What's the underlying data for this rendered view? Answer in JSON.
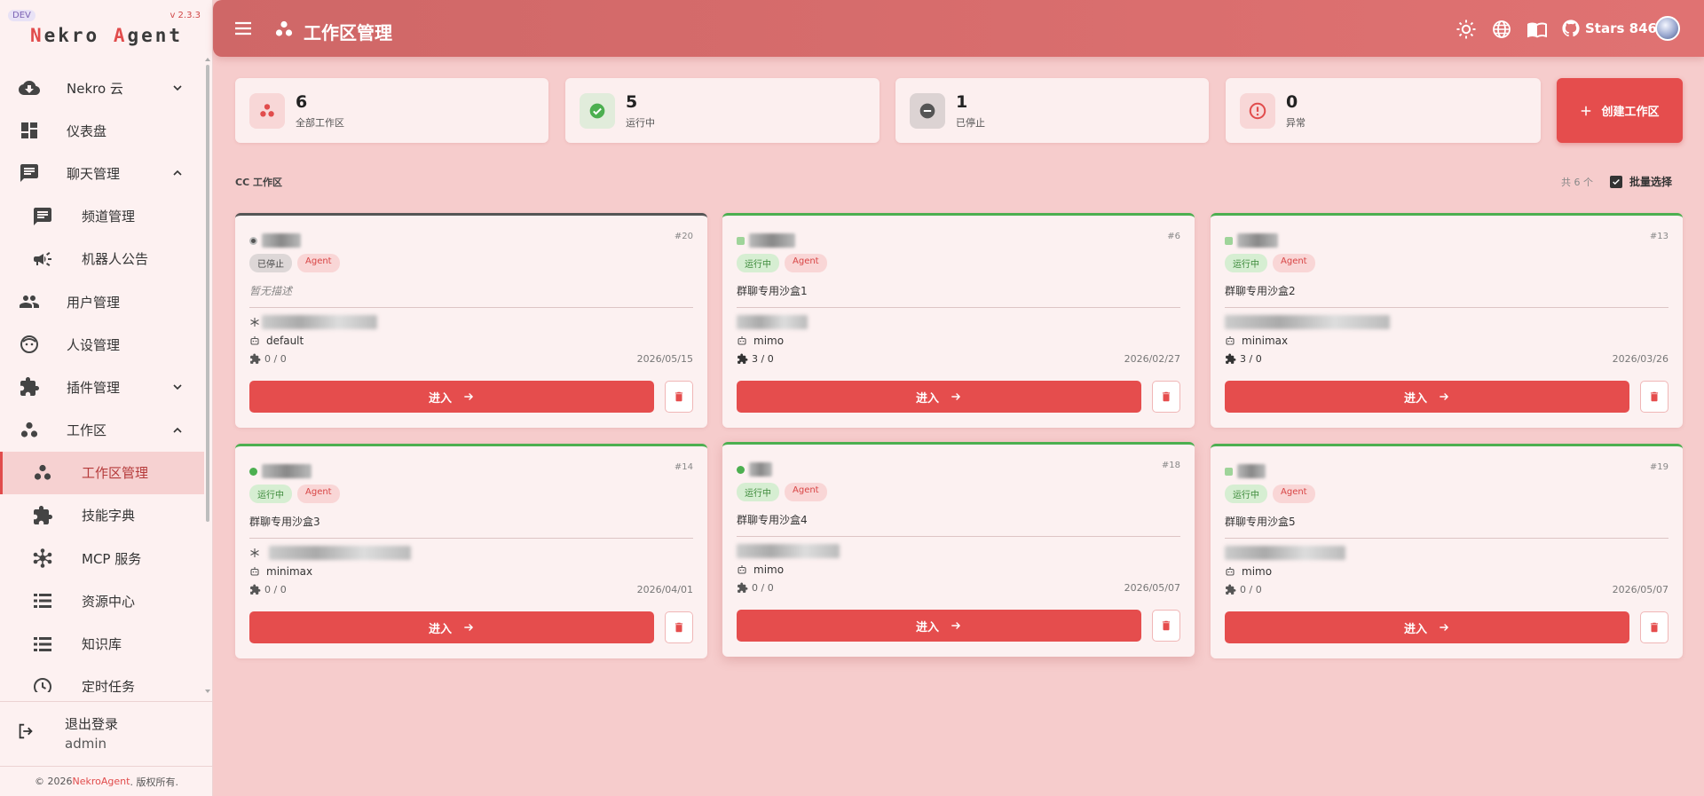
{
  "sidebar": {
    "dev_badge": "DEV",
    "version": "v 2.3.3",
    "brand_n": "N",
    "brand_ekro": "ekro ",
    "brand_a": "A",
    "brand_gent": "gent",
    "items": [
      {
        "label": "Nekro 云",
        "icon": "cloud-icon"
      },
      {
        "label": "仪表盘",
        "icon": "dashboard-icon"
      },
      {
        "label": "聊天管理",
        "icon": "chat-icon"
      },
      {
        "label": "频道管理",
        "icon": "channel-icon"
      },
      {
        "label": "机器人公告",
        "icon": "megaphone-icon"
      },
      {
        "label": "用户管理",
        "icon": "users-icon"
      },
      {
        "label": "人设管理",
        "icon": "persona-icon"
      },
      {
        "label": "插件管理",
        "icon": "puzzle-icon"
      },
      {
        "label": "工作区",
        "icon": "workspace-icon"
      },
      {
        "label": "工作区管理",
        "icon": "workspace-icon"
      },
      {
        "label": "技能字典",
        "icon": "puzzle-icon"
      },
      {
        "label": "MCP 服务",
        "icon": "hub-icon"
      },
      {
        "label": "资源中心",
        "icon": "list-icon"
      },
      {
        "label": "知识库",
        "icon": "list-icon"
      },
      {
        "label": "定时任务",
        "icon": "clock-icon"
      }
    ],
    "logout_label": "退出登录",
    "username": "admin",
    "footer_prefix": "© 2026 ",
    "footer_link": "NekroAgent",
    "footer_suffix": ". 版权所有."
  },
  "header": {
    "title": "工作区管理",
    "stars_label": "Stars 846"
  },
  "stats": [
    {
      "value": "6",
      "label": "全部工作区",
      "color": "#e14c4c"
    },
    {
      "value": "5",
      "label": "运行中",
      "color": "#4caf50"
    },
    {
      "value": "1",
      "label": "已停止",
      "color": "#555555"
    },
    {
      "value": "0",
      "label": "异常",
      "color": "#e14c4c"
    }
  ],
  "create_button": "创建工作区",
  "section": {
    "title": "CC 工作区",
    "count": "共 6 个",
    "batch_label": "批量选择"
  },
  "cards": [
    {
      "id": "#20",
      "status": "已停止",
      "agent": "Agent",
      "desc": "暂无描述",
      "model": "default",
      "plugins": "0 / 0",
      "date": "2026/05/15",
      "enter": "进入"
    },
    {
      "id": "#6",
      "status": "运行中",
      "agent": "Agent",
      "desc": "群聊专用沙盒1",
      "model": "mimo",
      "plugins": "3 / 0",
      "date": "2026/02/27",
      "enter": "进入"
    },
    {
      "id": "#13",
      "status": "运行中",
      "agent": "Agent",
      "desc": "群聊专用沙盒2",
      "model": "minimax",
      "plugins": "3 / 0",
      "date": "2026/03/26",
      "enter": "进入"
    },
    {
      "id": "#14",
      "status": "运行中",
      "agent": "Agent",
      "desc": "群聊专用沙盒3",
      "model": "minimax",
      "plugins": "0 / 0",
      "date": "2026/04/01",
      "enter": "进入"
    },
    {
      "id": "#18",
      "status": "运行中",
      "agent": "Agent",
      "desc": "群聊专用沙盒4",
      "model": "mimo",
      "plugins": "0 / 0",
      "date": "2026/05/07",
      "enter": "进入"
    },
    {
      "id": "#19",
      "status": "运行中",
      "agent": "Agent",
      "desc": "群聊专用沙盒5",
      "model": "mimo",
      "plugins": "0 / 0",
      "date": "2026/05/07",
      "enter": "进入"
    }
  ],
  "colors": {
    "accent": "#e54d4d",
    "running": "#4caf50",
    "stopped": "#555555"
  }
}
